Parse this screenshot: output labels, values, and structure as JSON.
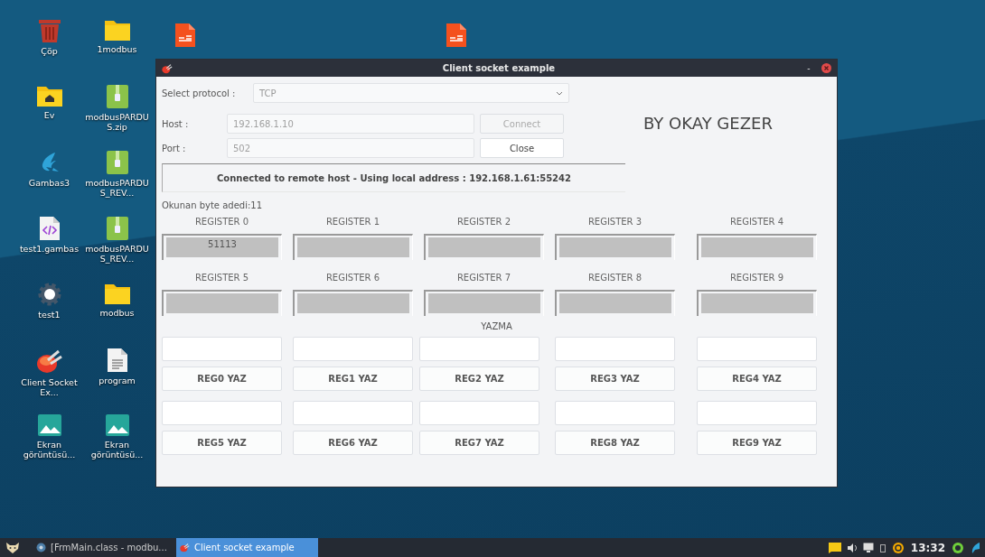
{
  "desktop": {
    "icons": [
      {
        "label": "Çöp",
        "kind": "trash"
      },
      {
        "label": "Ev",
        "kind": "home"
      },
      {
        "label": "Gambas3",
        "kind": "gambas"
      },
      {
        "label": "test1.gambas",
        "kind": "code"
      },
      {
        "label": "test1",
        "kind": "gear"
      },
      {
        "label": "Client Socket Ex...",
        "kind": "client"
      },
      {
        "label": "Ekran görüntüsü...",
        "kind": "image"
      },
      {
        "label": "1modbus",
        "kind": "folder"
      },
      {
        "label": "modbusPARDUS.zip",
        "kind": "archive"
      },
      {
        "label": "modbusPARDUS_REV...",
        "kind": "archive"
      },
      {
        "label": "modbusPARDUS_REV...",
        "kind": "archive"
      },
      {
        "label": "modbus",
        "kind": "folder"
      },
      {
        "label": "program",
        "kind": "text"
      },
      {
        "label": "Ekran görüntüsü...",
        "kind": "image"
      },
      {
        "kind": "slides"
      },
      {
        "kind": "slides"
      }
    ]
  },
  "window": {
    "title": "Client socket example",
    "minimize": "-",
    "protocol": {
      "label": "Select protocol :",
      "value": "TCP",
      "disabled": true
    },
    "host": {
      "label": "Host :",
      "value": "192.168.1.10",
      "disabled": true
    },
    "port": {
      "label": "Port :",
      "value": "502",
      "disabled": true
    },
    "buttons": [
      {
        "label": "Connect",
        "disabled": true
      },
      {
        "label": "Close",
        "disabled": false
      }
    ],
    "author": "BY OKAY GEZER",
    "status": "Connected to remote host - Using local address : 192.168.1.61:55242",
    "byte_count": "Okunan byte adedi:11",
    "registers": [
      {
        "label": "REGISTER 0",
        "value": "51113"
      },
      {
        "label": "REGISTER 1"
      },
      {
        "label": "REGISTER 2"
      },
      {
        "label": "REGISTER 3"
      },
      {
        "label": "REGISTER 4"
      },
      {
        "label": "REGISTER 5"
      },
      {
        "label": "REGISTER 6"
      },
      {
        "label": "REGISTER 7"
      },
      {
        "label": "REGISTER 8"
      },
      {
        "label": "REGISTER 9"
      }
    ],
    "write_title": "YAZMA",
    "write_groups": [
      [
        "REG0 YAZ",
        "REG1 YAZ",
        "REG2 YAZ",
        "REG3 YAZ",
        "REG4 YAZ"
      ],
      [
        "REG5 YAZ",
        "REG6 YAZ",
        "REG7 YAZ",
        "REG8 YAZ",
        "REG9 YAZ"
      ]
    ]
  },
  "taskbar": {
    "tasks": [
      {
        "label": "[FrmMain.class - modbu...",
        "selected": false
      },
      {
        "label": "Client socket example",
        "selected": true
      }
    ],
    "clock": "13:32"
  }
}
